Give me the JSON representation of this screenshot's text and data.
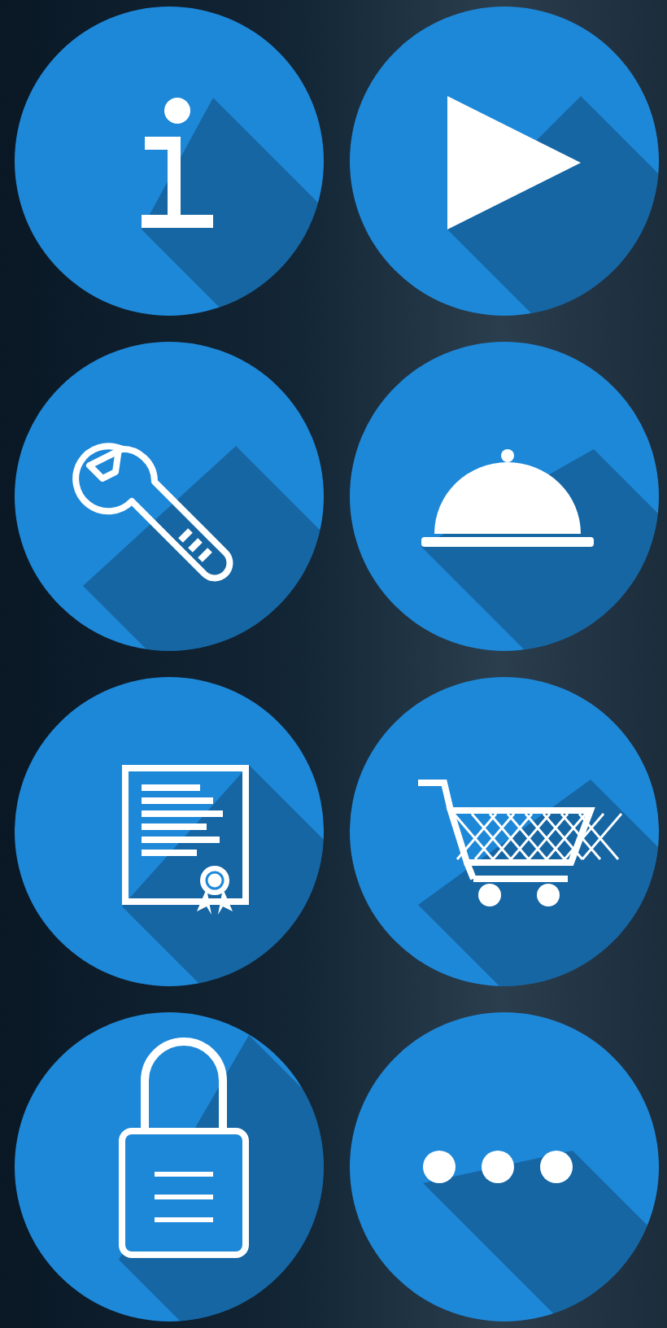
{
  "buttons": [
    {
      "kind": "info"
    },
    {
      "kind": "play"
    },
    {
      "kind": "wrench"
    },
    {
      "kind": "cloche"
    },
    {
      "kind": "certificate"
    },
    {
      "kind": "cart"
    },
    {
      "kind": "lock"
    },
    {
      "kind": "more"
    }
  ]
}
